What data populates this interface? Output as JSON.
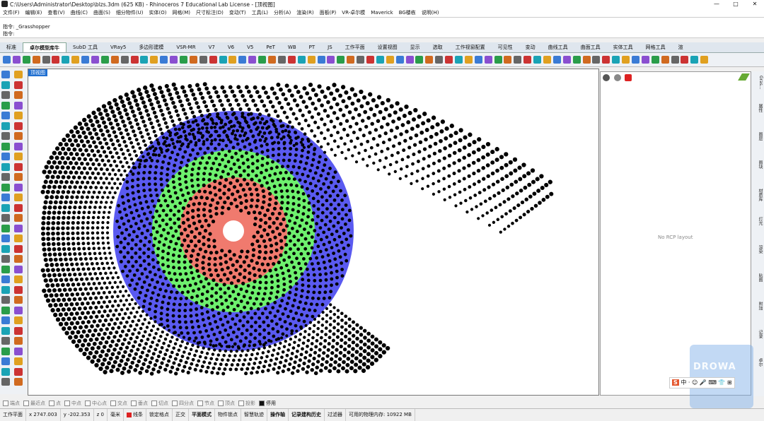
{
  "window": {
    "title": "C:\\Users\\Administrator\\Desktop\\blzs.3dm (625 KB) - Rhinoceros 7 Educational Lab License - [顶视图]",
    "minimize": "—",
    "maximize": "□",
    "close": "✕"
  },
  "menu": [
    "文件(F)",
    "编辑(E)",
    "查看(V)",
    "曲线(C)",
    "曲面(S)",
    "细分物件(U)",
    "实体(O)",
    "网格(M)",
    "尺寸标注(D)",
    "变动(T)",
    "工具(L)",
    "分析(A)",
    "渲染(R)",
    "面板(P)",
    "VR-卓尔模",
    "Maverick",
    "BG楼栋",
    "说明(H)"
  ],
  "command": {
    "history_line": "指令: _Grasshopper",
    "prompt": "指令:"
  },
  "tabs": [
    {
      "label": "标准",
      "active": false
    },
    {
      "label": "卓尔模型库牛",
      "active": true
    },
    {
      "label": "SubD 工具",
      "active": false
    },
    {
      "label": "VRay5",
      "active": false
    },
    {
      "label": "多边形建模",
      "active": false
    },
    {
      "label": "VSR-MR",
      "active": false
    },
    {
      "label": "V7",
      "active": false
    },
    {
      "label": "V6",
      "active": false
    },
    {
      "label": "V5",
      "active": false
    },
    {
      "label": "PeT",
      "active": false
    },
    {
      "label": "WB",
      "active": false
    },
    {
      "label": "PT",
      "active": false
    },
    {
      "label": "JS",
      "active": false
    },
    {
      "label": "工作平面",
      "active": false
    },
    {
      "label": "设置视图",
      "active": false
    },
    {
      "label": "显示",
      "active": false
    },
    {
      "label": "选取",
      "active": false
    },
    {
      "label": "工作视窗配置",
      "active": false
    },
    {
      "label": "可见性",
      "active": false
    },
    {
      "label": "变动",
      "active": false
    },
    {
      "label": "曲线工具",
      "active": false
    },
    {
      "label": "曲面工具",
      "active": false
    },
    {
      "label": "实体工具",
      "active": false
    },
    {
      "label": "网格工具",
      "active": false
    },
    {
      "label": "渲",
      "active": false
    }
  ],
  "viewport": {
    "label": "顶视图",
    "rings": {
      "outer_color": "#000000",
      "blue": "#5a5af0",
      "green": "#6ef06e",
      "red": "#f07a6e",
      "center": "#ffffff"
    }
  },
  "right_panel": {
    "empty_text": "No RCP layout"
  },
  "side_tabs": [
    "Gras...",
    "属性",
    "图层",
    "图块",
    "材质库",
    "灯光",
    "渲染",
    "贴图",
    "附加",
    "记录",
    "卓尔"
  ],
  "osnap": [
    {
      "label": "端点",
      "on": false
    },
    {
      "label": "最近点",
      "on": false
    },
    {
      "label": "点",
      "on": false
    },
    {
      "label": "中点",
      "on": false
    },
    {
      "label": "中心点",
      "on": false
    },
    {
      "label": "交点",
      "on": false
    },
    {
      "label": "垂点",
      "on": false
    },
    {
      "label": "切点",
      "on": false
    },
    {
      "label": "四分点",
      "on": false
    },
    {
      "label": "节点",
      "on": false
    },
    {
      "label": "顶点",
      "on": false
    },
    {
      "label": "投影",
      "on": false
    },
    {
      "label": "停用",
      "on": true
    }
  ],
  "status": {
    "plane": "工作平面",
    "x": "x 2747.003",
    "y": "y -202.353",
    "z": "z 0",
    "unit": "毫米",
    "layer": "线条",
    "toggles": [
      "锁定格点",
      "正交",
      "平面模式",
      "物件锁点",
      "智慧轨迹",
      "操作轴",
      "记录建构历史",
      "过滤器"
    ],
    "memory": "可用的物理内存: 10922 MB"
  },
  "watermark": "DROWA",
  "ime": {
    "logo": "S",
    "text": "中 · ☺ 🎤 ⌨ 👕 ⊞"
  }
}
